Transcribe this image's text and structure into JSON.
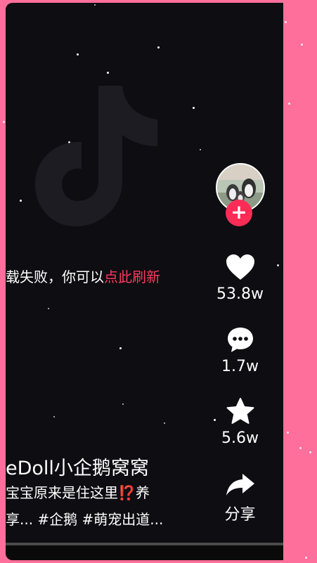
{
  "video": {
    "load_fail_text": "载失败，你可以",
    "refresh_link": "点此刷新"
  },
  "actions": {
    "like_count": "53.8w",
    "comment_count": "1.7w",
    "favorite_count": "5.6w",
    "share_label": "分享"
  },
  "caption": {
    "author": "eDoll小企鹅窝窝",
    "line1": "宝宝原来是住这里⁉️养",
    "line2": "享... #企鹅 #萌宠出道..."
  },
  "icons": [
    "douyin-logo-watermark",
    "heart-icon",
    "comment-icon",
    "star-icon",
    "share-icon",
    "plus-icon"
  ],
  "colors": {
    "background": "#ff6f9b",
    "screen": "#0d0d12",
    "accent": "#fd2c56",
    "refresh": "#ff3a5c"
  }
}
